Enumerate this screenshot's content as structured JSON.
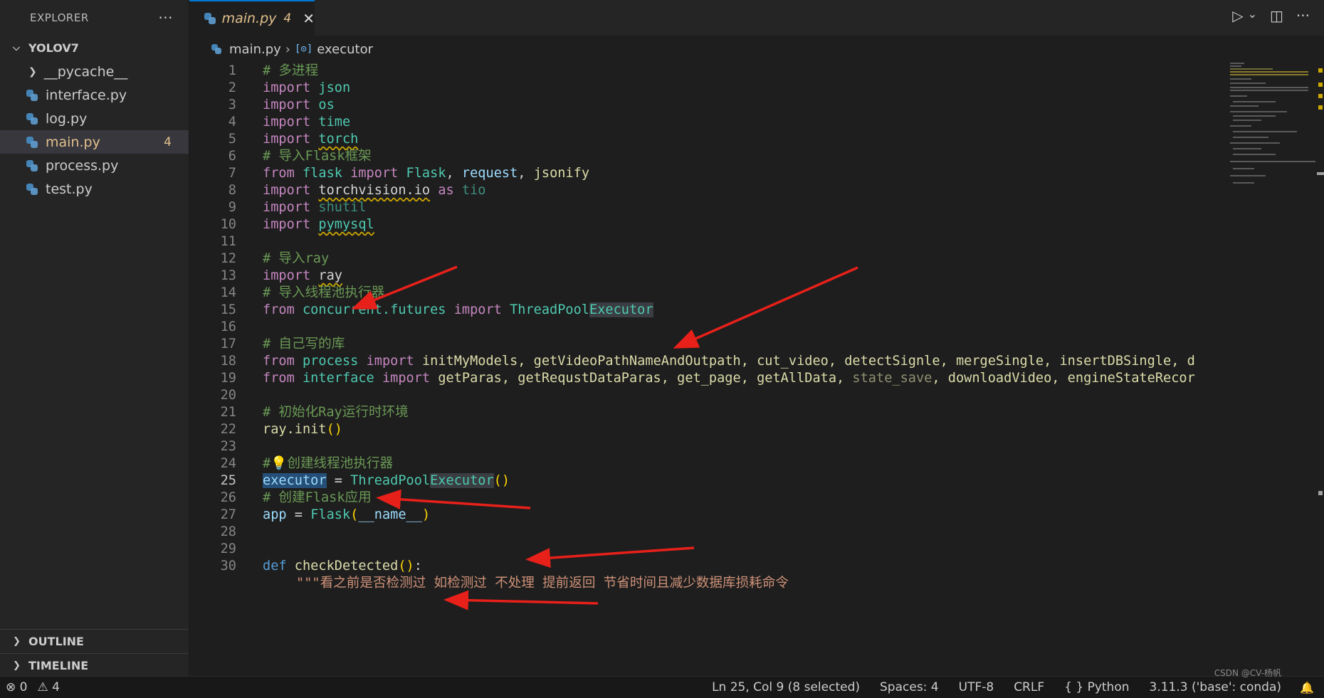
{
  "explorer": {
    "title": "EXPLORER",
    "more": "···",
    "project": "YOLOV7",
    "items": [
      {
        "label": "__pycache__",
        "type": "folder"
      },
      {
        "label": "interface.py",
        "type": "file"
      },
      {
        "label": "log.py",
        "type": "file"
      },
      {
        "label": "main.py",
        "type": "file",
        "badge": "4"
      },
      {
        "label": "process.py",
        "type": "file"
      },
      {
        "label": "test.py",
        "type": "file"
      }
    ],
    "outline": "OUTLINE",
    "timeline": "TIMELINE"
  },
  "tab": {
    "label": "main.py",
    "badge": "4",
    "close": "✕"
  },
  "tab_actions": {
    "run": "▷",
    "run_menu": "⌄",
    "split": "◫",
    "more": "···"
  },
  "breadcrumb": {
    "file": "main.py",
    "sep": "›",
    "symbol_icon": "[⊙]",
    "symbol": "executor"
  },
  "editor": {
    "lines": [
      "1",
      "2",
      "3",
      "4",
      "5",
      "6",
      "7",
      "8",
      "9",
      "10",
      "11",
      "12",
      "13",
      "14",
      "15",
      "16",
      "17",
      "18",
      "19",
      "20",
      "21",
      "22",
      "23",
      "24",
      "25",
      "26",
      "27",
      "28",
      "29",
      "30"
    ],
    "active_line": "25",
    "code": {
      "l1": "# 多进程",
      "import": "import",
      "from": "from",
      "as": "as",
      "json": "json",
      "os": "os",
      "time": "time",
      "torch": "torch",
      "l6": "# 导入Flask框架",
      "flask": "flask",
      "Flask": "Flask",
      "request": "request",
      "jsonify": "jsonify",
      "torchvision_io": "torchvision.io",
      "tio": "tio",
      "shutil": "shutil",
      "pymysql": "pymysql",
      "l12": "# 导入ray",
      "ray": "ray",
      "l14": "# 导入线程池执行器",
      "concurrent_futures": "concurrent.futures",
      "ThreadPool": "ThreadPool",
      "Executor": "Executor",
      "l17": "# 自己写的库",
      "process": "process",
      "l18_names": "initMyModels, getVideoPathNameAndOutpath, cut_video, detectSignle, mergeSingle, insertDBSingle, d",
      "interface": "interface",
      "l19_names_a": "getParas, getRequstDataParas, get_page, getAllData, ",
      "state_save": "state_save",
      "l19_names_b": ", downloadVideo, engineStateRecor",
      "l21": "# 初始化Ray运行时环境",
      "ray_init": "ray.init",
      "l24": "#💡创建线程池执行器",
      "executor": "executor",
      "eq": " = ",
      "l26": "# 创建Flask应用",
      "app": "app",
      "dunder_name": "__name__",
      "def": "def",
      "checkDetected": "checkDetected",
      "l31": "\"\"\"看之前是否检测过 如检测过 不处理 提前返回 节省时间且减少数据库损耗命令"
    }
  },
  "status": {
    "errors": "⊗ 0",
    "warnings": "⚠ 4",
    "position": "Ln 25, Col 9 (8 selected)",
    "spaces": "Spaces: 4",
    "encoding": "UTF-8",
    "eol": "CRLF",
    "lang_icon": "{ }",
    "language": "Python",
    "interpreter": "3.11.3 ('base': conda)",
    "watermark": "CSDN @CV-杨帆",
    "bell": "🔔"
  },
  "colors": {
    "accent": "#0078d4",
    "modified": "#e2c08d",
    "annotation_arrow": "#e8201a"
  }
}
